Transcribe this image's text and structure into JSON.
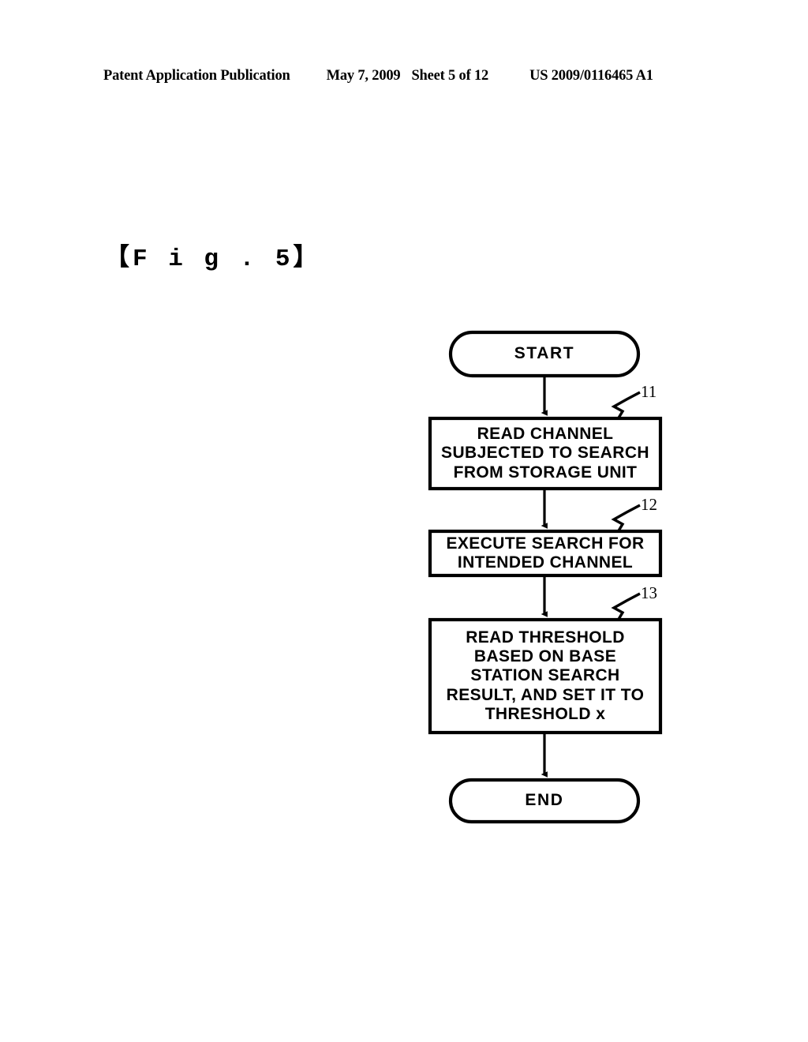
{
  "page": {
    "header": {
      "publication": "Patent Application Publication",
      "date": "May 7, 2009",
      "sheet": "Sheet 5 of 12",
      "patent_number": "US 2009/0116465 A1"
    },
    "figure_label": "【F i g .  5】"
  },
  "figure": {
    "nodes": [
      {
        "id": "start",
        "shape": "terminator",
        "lines": [
          "START"
        ]
      },
      {
        "id": "step-11",
        "shape": "process",
        "ref": "11",
        "lines": [
          "READ CHANNEL",
          "SUBJECTED TO SEARCH",
          "FROM STORAGE UNIT"
        ]
      },
      {
        "id": "step-12",
        "shape": "process",
        "ref": "12",
        "lines": [
          "EXECUTE SEARCH FOR",
          "INTENDED CHANNEL"
        ]
      },
      {
        "id": "step-13",
        "shape": "process",
        "ref": "13",
        "lines": [
          "READ THRESHOLD",
          "BASED ON BASE",
          "STATION SEARCH",
          "RESULT, AND SET IT TO",
          "THRESHOLD x"
        ]
      },
      {
        "id": "end",
        "shape": "terminator",
        "lines": [
          "END"
        ]
      }
    ],
    "reference_numerals": [
      "11",
      "12",
      "13"
    ],
    "colors": {
      "stroke": "#000000",
      "fill": "#ffffff",
      "background": "#ffffff"
    }
  }
}
